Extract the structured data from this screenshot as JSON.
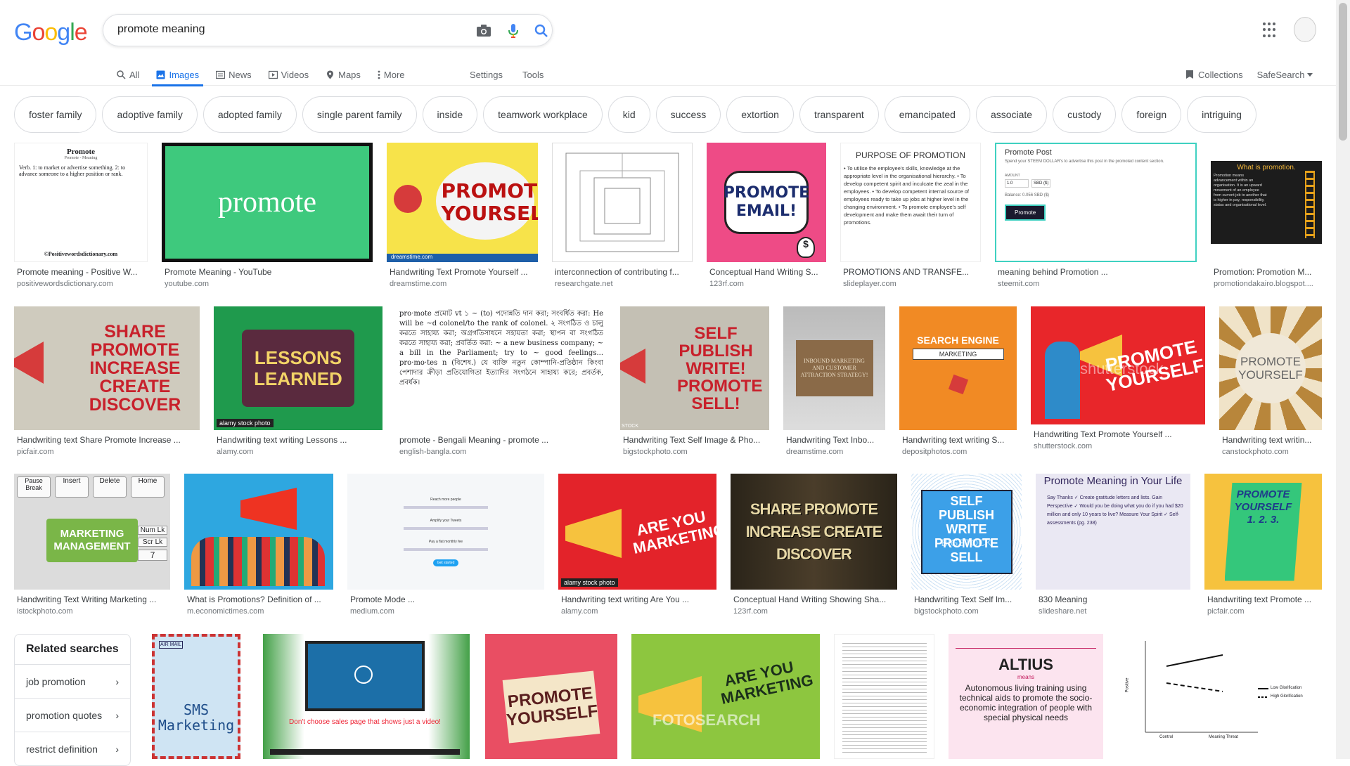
{
  "logo": {
    "g1": "G",
    "o1": "o",
    "o2": "o",
    "g2": "g",
    "l": "l",
    "e": "e",
    "colors": [
      "#4285F4",
      "#EA4335",
      "#FBBC05",
      "#4285F4",
      "#34A853",
      "#EA4335"
    ]
  },
  "search": {
    "value": "promote meaning"
  },
  "tabs": [
    {
      "label": "All",
      "icon": "search-icon"
    },
    {
      "label": "Images",
      "icon": "image-icon"
    },
    {
      "label": "News",
      "icon": "newspaper-icon"
    },
    {
      "label": "Videos",
      "icon": "play-icon"
    },
    {
      "label": "Maps",
      "icon": "map-pin-icon"
    },
    {
      "label": "More",
      "icon": "more-vert-icon"
    }
  ],
  "tools": {
    "settings": "Settings",
    "tools": "Tools"
  },
  "right": {
    "collections": "Collections",
    "safesearch": "SafeSearch"
  },
  "chips": [
    "foster family",
    "adoptive family",
    "adopted family",
    "single parent family",
    "inside",
    "teamwork workplace",
    "kid",
    "success",
    "extortion",
    "transparent",
    "emancipated",
    "associate",
    "custody",
    "foreign",
    "intriguing"
  ],
  "row1": [
    {
      "cap": "Promote meaning - Positive W...",
      "src": "positivewordsdictionary.com",
      "title": "Promote",
      "sub": "Promote - Meaning",
      "body": "Verb. 1: to market or advertise something. 2: to advance someone to a higher position or rank.",
      "foot": "©Positivewordsdictionary.com"
    },
    {
      "cap": "Promote Meaning - YouTube",
      "src": "youtube.com",
      "text": "promote"
    },
    {
      "cap": "Handwriting Text Promote Yourself ...",
      "src": "dreamstime.com",
      "text": "PROMOTE YOURSELF",
      "wm": "dreamstime.com"
    },
    {
      "cap": "interconnection of contributing f...",
      "src": "researchgate.net"
    },
    {
      "cap": "Conceptual Hand Writing S...",
      "src": "123rf.com",
      "text": "PROMOTE EMAIL!"
    },
    {
      "cap": "PROMOTIONS AND TRANSFE...",
      "src": "slideplayer.com",
      "title": "PURPOSE OF PROMOTION",
      "body": "• To utilise the employee's skills, knowledge at the appropriate level in the organisational hierarchy. • To develop competent spirit and inculcate the zeal in the employees. • To develop competent internal source of employees ready to take up jobs at higher level in the changing environment. • To promote employee's self development and make them await their turn of promotions."
    },
    {
      "cap": "meaning behind Promotion ...",
      "src": "steemit.com",
      "title": "Promote Post",
      "body": "Spend your STEEM DOLLAR's to advertise this post in the promoted content section.",
      "amount": "AMOUNT",
      "val": "1.0",
      "cur": "SBD ($)",
      "bal": "Balance: 0.056 SBD ($)",
      "btn": "Promote"
    },
    {
      "cap": "Promotion: Promotion M...",
      "src": "promotiondakairo.blogspot....",
      "title": "What is promotion.",
      "body": "Promotion means advancement within an organisation. It is an upward movement of an employee from current job to another that is higher in pay, responsibility, status and organisational level."
    }
  ],
  "row2": [
    {
      "cap": "Handwriting text Share Promote Increase ...",
      "src": "picfair.com",
      "text": "SHARE PROMOTE INCREASE CREATE DISCOVER"
    },
    {
      "cap": "Handwriting text writing Lessons ...",
      "src": "alamy.com",
      "text": "LESSONS LEARNED",
      "wm": "alamy stock photo"
    },
    {
      "cap": "promote - Bengali Meaning - promote ...",
      "src": "english-bangla.com",
      "text": "pro·mote প্রমোট vt ১ ~ (to) পদোন্নতি দান করা; সংবর্ধিত করা: He will be ~d colonel/to the rank of colonel. ২ সংগঠিত ও চালু করতে সাহায্য করা; অগ্রগতিসাধনে সহায়তা করা; স্থাপন বা সংগঠিত করতে সাহায্য করা; প্রবর্তিত করা: ~ a new business company; ~ a bill in the Parliament; try to ~ good feelings... pro·mo·tes n (বিশেষ.) যে ব্যক্তি নতুন কোম্পানি-প্রতিষ্ঠান কিংবা পেশাদার ক্রীড়া প্রতিযোগিতা ইত্যাদির সংগঠনে সাহায্য করে; প্রবর্তক, প্রবর্ধক।"
    },
    {
      "cap": "Handwriting Text Self Image & Pho...",
      "src": "bigstockphoto.com",
      "text": "SELF PUBLISH WRITE! PROMOTE SELL!",
      "wm": "STOCK"
    },
    {
      "cap": "Handwriting Text Inbo...",
      "src": "dreamstime.com",
      "text": "INBOUND MARKETING AND CUSTOMER ATTRACTION STRATEGY!"
    },
    {
      "cap": "Handwriting text writing S...",
      "src": "depositphotos.com",
      "text": "SEARCH ENGINE",
      "sub": "MARKETING"
    },
    {
      "cap": "Handwriting Text Promote Yourself ...",
      "src": "shutterstock.com",
      "text": "PROMOTE YOURSELF",
      "wm": "shutterstock"
    },
    {
      "cap": "Handwriting text writin...",
      "src": "canstockphoto.com",
      "text": "PROMOTE YOURSELF"
    }
  ],
  "row3": [
    {
      "cap": "Handwriting Text Writing Marketing ...",
      "src": "istockphoto.com",
      "keys": [
        "Pause Break",
        "Insert",
        "Delete",
        "Home",
        "Num Lk",
        "Scr Lk",
        "7"
      ],
      "text": "MARKETING MANAGEMENT"
    },
    {
      "cap": "What is Promotions? Definition of ...",
      "src": "m.economictimes.com"
    },
    {
      "cap": "Promote Mode ...",
      "src": "medium.com",
      "l1": "Reach more people",
      "l2": "Amplify your Tweets",
      "l3": "Pay a flat monthly fee",
      "btn": "Get started"
    },
    {
      "cap": "Handwriting text writing Are You ...",
      "src": "alamy.com",
      "text": "ARE YOU MARKETING",
      "wm": "alamy stock photo"
    },
    {
      "cap": "Conceptual Hand Writing Showing Sha...",
      "src": "123rf.com",
      "text": "SHARE PROMOTE INCREASE CREATE DISCOVER"
    },
    {
      "cap": "Handwriting Text Self Im...",
      "src": "bigstockphoto.com",
      "text": "SELF PUBLISH WRITE PROMOTE SELL",
      "wm": "BIGSTOCK"
    },
    {
      "cap": "830 Meaning",
      "src": "slideshare.net",
      "title": "Promote Meaning in Your Life",
      "body": "Say Thanks ✓ Create gratitude letters and lists. Gain Perspective ✓ Would you be doing what you do if you had $20 million and only 10 years to live? Measure Your Spirit ✓ Self-assessments (pg. 238)"
    },
    {
      "cap": "Handwriting text Promote ...",
      "src": "picfair.com",
      "text": "PROMOTE YOURSELF 1. 2. 3."
    }
  ],
  "row4": [
    {
      "text": "SMS Marketing",
      "sub": "AIR MAIL"
    },
    {
      "text": "Don't choose sales page that shows just a video!"
    },
    {
      "text": "PROMOTE YOURSELF"
    },
    {
      "text": "ARE YOU MARKETING",
      "wm": "FOTOSEARCH"
    },
    {},
    {
      "title": "ALTIUS",
      "sub": "means",
      "body": "Autonomous living training using technical aids to promote the socio-economic integration of people with special physical needs"
    },
    {
      "legend1": "Low Glorification",
      "legend2": "High Glorification",
      "xl1": "Control",
      "xl2": "Meaning Threat",
      "ylabel": "Positive",
      "ticks": [
        "9",
        "8",
        "7",
        "6",
        "5",
        "4",
        "3",
        "2",
        "1"
      ]
    }
  ],
  "related": {
    "title": "Related searches",
    "items": [
      "job promotion",
      "promotion quotes",
      "restrict definition"
    ]
  }
}
